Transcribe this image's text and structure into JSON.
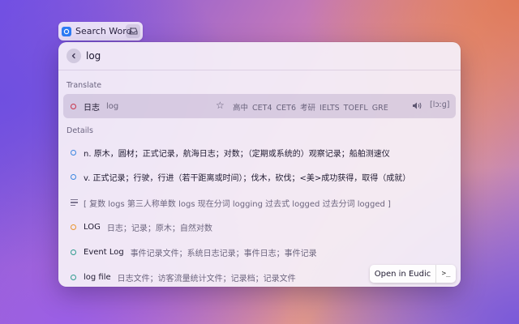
{
  "extension": {
    "label": "Search Word"
  },
  "search": {
    "value": "log"
  },
  "sections": {
    "translate": "Translate",
    "details": "Details"
  },
  "translation": {
    "word": "日志",
    "original": "log",
    "tags": "高中 CET4 CET6 考研 IELTS TOEFL GRE",
    "phonetic": "[lɔːɡ]"
  },
  "details": [
    {
      "dot": "blue",
      "text": "n. 原木，圆材；正式记录，航海日志；对数；（定期或系统的）观察记录；船舶测速仪"
    },
    {
      "dot": "blue",
      "text": "v. 正式记录；行驶，行进（若干距离或时间）；伐木，砍伐；<美>成功获得，取得（成就）"
    },
    {
      "icon": "lines",
      "text": "[ 复数 logs   第三人称单数 logs   现在分词 logging   过去式 logged   过去分词 logged ]"
    },
    {
      "dot": "orange",
      "term": "LOG",
      "meaning": "日志；记录；原木；自然对数"
    },
    {
      "dot": "teal",
      "term": "Event Log",
      "meaning": "事件记录文件；系统日志记录；事件日志；事件记录"
    },
    {
      "dot": "teal",
      "term": "log file",
      "meaning": "日志文件；访客流量统计文件；记录档；记录文件"
    }
  ],
  "actions": {
    "open_eudic": "Open in Eudic",
    "terminal": ">_"
  },
  "colors": {
    "accent_blue": "#3a86e0",
    "red": "#c8344a",
    "orange": "#e8952e",
    "teal": "#2f9c8e"
  }
}
